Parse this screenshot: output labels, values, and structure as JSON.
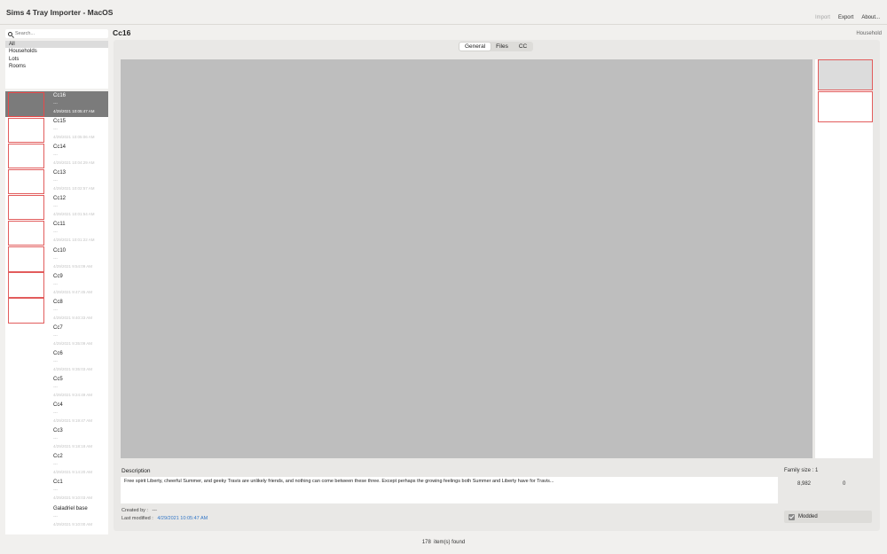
{
  "window": {
    "title": "Sims 4 Tray Importer - MacOS"
  },
  "top_menu": {
    "import": "Import",
    "export": "Export",
    "about": "About..."
  },
  "search": {
    "placeholder": "Search..."
  },
  "filters": [
    "All",
    "Households",
    "Lots",
    "Rooms"
  ],
  "items": [
    {
      "name": "Cc16",
      "sub": "---",
      "date": "4/29/2021 10:05:47 AM"
    },
    {
      "name": "Cc15",
      "sub": "---",
      "date": "4/29/2021 10:05:06 AM"
    },
    {
      "name": "Cc14",
      "sub": "---",
      "date": "4/29/2021 10:04:29 AM"
    },
    {
      "name": "Cc13",
      "sub": "---",
      "date": "4/29/2021 10:02:57 AM"
    },
    {
      "name": "Cc12",
      "sub": "---",
      "date": "4/29/2021 10:01:54 AM"
    },
    {
      "name": "Cc11",
      "sub": "---",
      "date": "4/29/2021 10:01:22 AM"
    },
    {
      "name": "Cc10",
      "sub": "---",
      "date": "4/29/2021 9:54:09 AM"
    },
    {
      "name": "Cc9",
      "sub": "---",
      "date": "4/29/2021 9:47:45 AM"
    },
    {
      "name": "Cc8",
      "sub": "---",
      "date": "4/29/2021 9:40:33 AM"
    },
    {
      "name": "Cc7",
      "sub": "---",
      "date": "4/29/2021 9:35:09 AM"
    },
    {
      "name": "Cc6",
      "sub": "---",
      "date": "4/29/2021 9:35:03 AM"
    },
    {
      "name": "Cc5",
      "sub": "---",
      "date": "4/29/2021 9:24:49 AM"
    },
    {
      "name": "Cc4",
      "sub": "---",
      "date": "4/29/2021 9:19:47 AM"
    },
    {
      "name": "Cc3",
      "sub": "---",
      "date": "4/29/2021 9:18:18 AM"
    },
    {
      "name": "Cc2",
      "sub": "---",
      "date": "4/29/2021 9:14:20 AM"
    },
    {
      "name": "Cc1",
      "sub": "---",
      "date": "4/29/2021 9:10:03 AM"
    },
    {
      "name": "Galadriel base",
      "sub": "---",
      "date": "4/29/2021 9:10:00 AM"
    }
  ],
  "detail": {
    "title": "Cc16",
    "type": "Household",
    "tabs": [
      "General",
      "Files",
      "CC"
    ],
    "description_label": "Description",
    "description": "Free spirit Liberty, cheerful Summer, and geeky Travis are unlikely friends, and nothing can come between these three. Except perhaps the growing feelings both Summer and Liberty have for Travis...",
    "created_by_label": "Created by :",
    "created_by": "---",
    "last_modified_label": "Last modified :",
    "last_modified": "4/29/2021 10:05:47 AM",
    "family_size_label": "Family size :",
    "family_size": "1",
    "stat_1": "8,982",
    "stat_2": "0",
    "modded_label": "Modded"
  },
  "status": {
    "count": "178",
    "label": "item(s) found"
  },
  "colors": {
    "accent": "#3478c8",
    "thumb_border": "#e25c5c",
    "selected_row": "#7b7b7b"
  }
}
